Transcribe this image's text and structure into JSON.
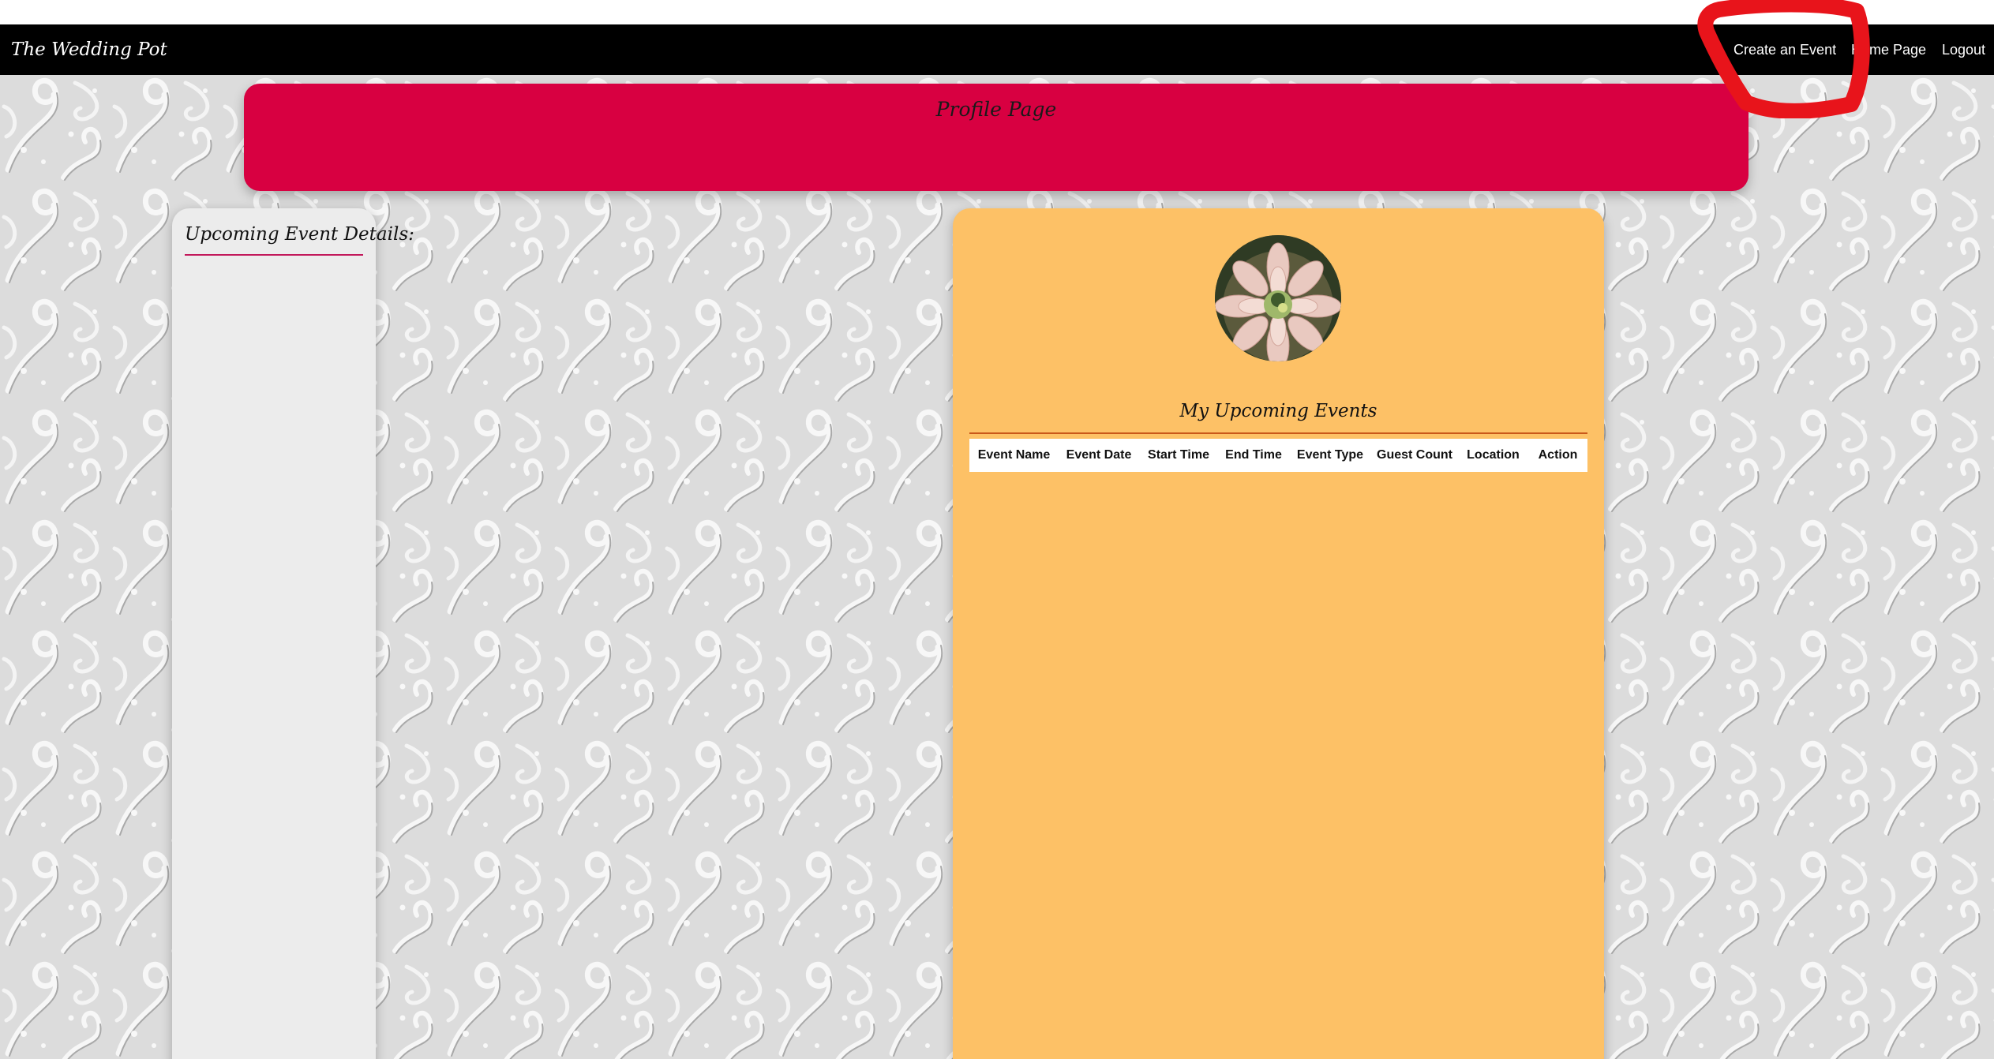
{
  "navbar": {
    "brand": "The Wedding Pot",
    "links": [
      {
        "label": "Create an Event"
      },
      {
        "label": "Home Page"
      },
      {
        "label": "Logout"
      }
    ]
  },
  "profile": {
    "title": "Profile Page"
  },
  "left_panel": {
    "title": "Upcoming Event Details:"
  },
  "right_panel": {
    "avatar_icon": "flower-photo",
    "events_title": "My Upcoming Events",
    "table": {
      "columns": [
        "Event Name",
        "Event Date",
        "Start Time",
        "End Time",
        "Event Type",
        "Guest Count",
        "Location",
        "Action"
      ],
      "rows": []
    }
  },
  "colors": {
    "navbar": "#000000",
    "banner": "#d80041",
    "events_panel": "#fdc166",
    "details_panel": "#ececec",
    "annotation": "#e8141b"
  }
}
